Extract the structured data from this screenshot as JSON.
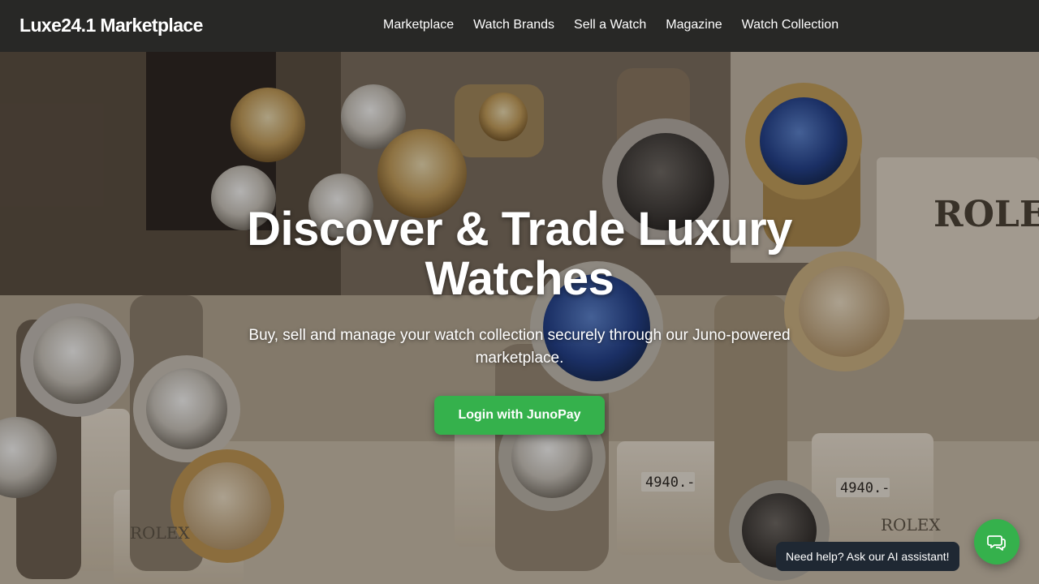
{
  "brand": {
    "name": "Luxe24.1 Marketplace"
  },
  "nav": {
    "links": [
      {
        "label": "Marketplace"
      },
      {
        "label": "Watch Brands"
      },
      {
        "label": "Sell a Watch"
      },
      {
        "label": "Magazine"
      },
      {
        "label": "Watch Collection"
      }
    ]
  },
  "hero": {
    "title": "Discover & Trade Luxury Watches",
    "subtitle": "Buy, sell and manage your watch collection securely through our Juno-powered marketplace.",
    "cta_label": "Login with JunoPay",
    "background": {
      "description_icon": "watch-display-photo",
      "display_texts": [
        "ROLEX",
        "ROLEX",
        "ROLEX",
        "4940.-",
        "4940.-"
      ]
    }
  },
  "chat": {
    "tooltip": "Need help? Ask our AI assistant!",
    "icon": "chat-bubbles-icon"
  },
  "colors": {
    "navbar": "#282826",
    "accent": "#35b14c",
    "tooltip": "#1f2833"
  }
}
